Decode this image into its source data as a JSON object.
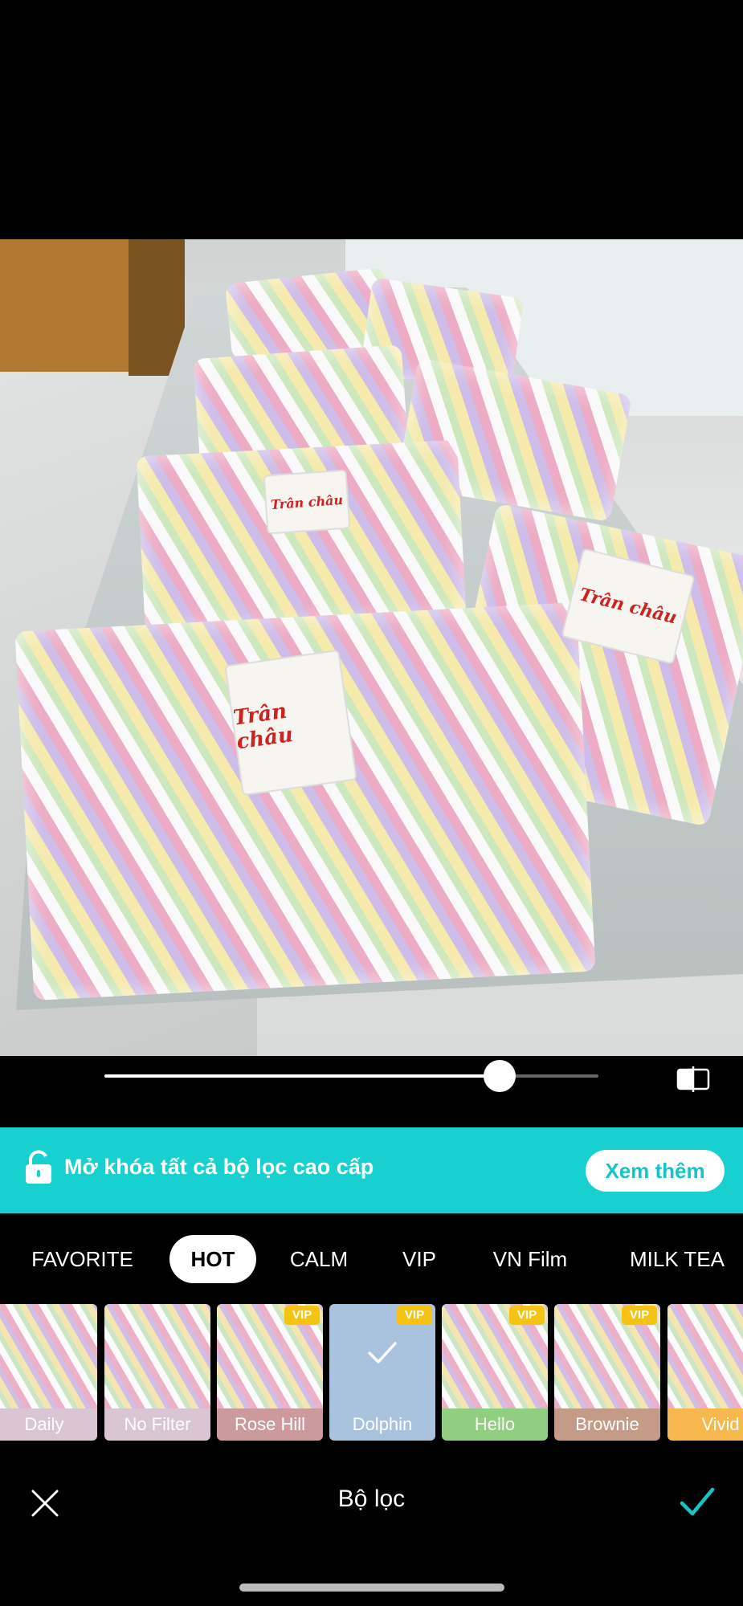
{
  "photo": {
    "bag_label_text": "Trân châu"
  },
  "slider": {
    "value_percent": 80
  },
  "banner": {
    "text": "Mở khóa tất cả bộ lọc cao cấp",
    "button_label": "Xem thêm",
    "background_color": "#17d0cf"
  },
  "tabs": [
    {
      "label": "FAVORITE",
      "active": false
    },
    {
      "label": "HOT",
      "active": true
    },
    {
      "label": "CALM",
      "active": false
    },
    {
      "label": "VIP",
      "active": false
    },
    {
      "label": "VN Film",
      "active": false
    },
    {
      "label": "MILK TEA",
      "active": false
    }
  ],
  "filters": [
    {
      "name": "Daily",
      "vip": false,
      "selected": false,
      "label_color": "#d9c5d3"
    },
    {
      "name": "No Filter",
      "vip": false,
      "selected": false,
      "label_color": "#d9c5d3"
    },
    {
      "name": "Rose Hill",
      "vip": true,
      "selected": false,
      "label_color": "#cc9a9c"
    },
    {
      "name": "Dolphin",
      "vip": true,
      "selected": true,
      "label_color": "#a9c3df"
    },
    {
      "name": "Hello",
      "vip": true,
      "selected": false,
      "label_color": "#8fcf7f"
    },
    {
      "name": "Brownie",
      "vip": true,
      "selected": false,
      "label_color": "#c49b87"
    },
    {
      "name": "Vivid",
      "vip": false,
      "selected": false,
      "label_color": "#f7b84d"
    }
  ],
  "vip_badge": "VIP",
  "bottom_bar": {
    "title": "Bộ lọc",
    "close_icon": "close-icon",
    "confirm_icon": "check-icon",
    "accent_color": "#17c4c4"
  }
}
